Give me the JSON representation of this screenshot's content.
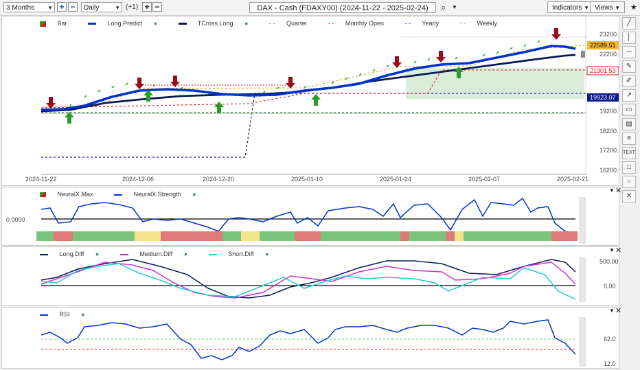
{
  "toolbar": {
    "period": "3 Months",
    "interval": "Daily",
    "offset": "(+1)",
    "plus": "+",
    "minus": "−",
    "title": "DAX - Cash (FDAXY00) (2024-11-22 - 2025-02-24)",
    "indicators": "Indicators",
    "views": "Views"
  },
  "main_legend": [
    "Bar",
    "Long.Predict",
    "TCross.Long",
    "Quarter",
    "Monthly Open",
    "Yearly",
    "Weekly"
  ],
  "price_axis": [
    "23200.00",
    "22200.00",
    "19200.00",
    "18200.00",
    "17200.00",
    "16200.00"
  ],
  "price_tags": {
    "weekly": "22589.51",
    "monthly": "21301.53",
    "quarter": "19923.07"
  },
  "date_axis": [
    "2024-11-22",
    "2024-12-06",
    "2024-12-20",
    "2025-01-10",
    "2025-01-24",
    "2025-02-07",
    "2025-02-21"
  ],
  "neural_legend": [
    "NeuralX.Max",
    "NeuralX.Strength"
  ],
  "neural_value": "0.0000",
  "diff_legend": [
    "Long.Diff",
    "Medium.Diff",
    "Short.Diff"
  ],
  "diff_axis": [
    "500.00",
    "0.00"
  ],
  "rsi_legend": [
    "RSI"
  ],
  "rsi_axis": [
    "62.0",
    "12.0"
  ],
  "side_tools": [
    "pencil-icon",
    "vertical-line-icon",
    "horizontal-line-icon",
    "pen-icon",
    "brush-icon",
    "arrow-icon",
    "callout-icon",
    "rectangle-text-icon",
    "fibonacci-icon",
    "text-icon",
    "square-icon",
    "circle-icon",
    "delete-icon"
  ],
  "side_tools_text": "TEXT",
  "colors": {
    "blue": "#0033cc",
    "navy": "#0a1a55",
    "red": "#cc1a1a",
    "green": "#2a9a2a",
    "magenta": "#cc33cc",
    "cyan": "#22cccc"
  }
}
